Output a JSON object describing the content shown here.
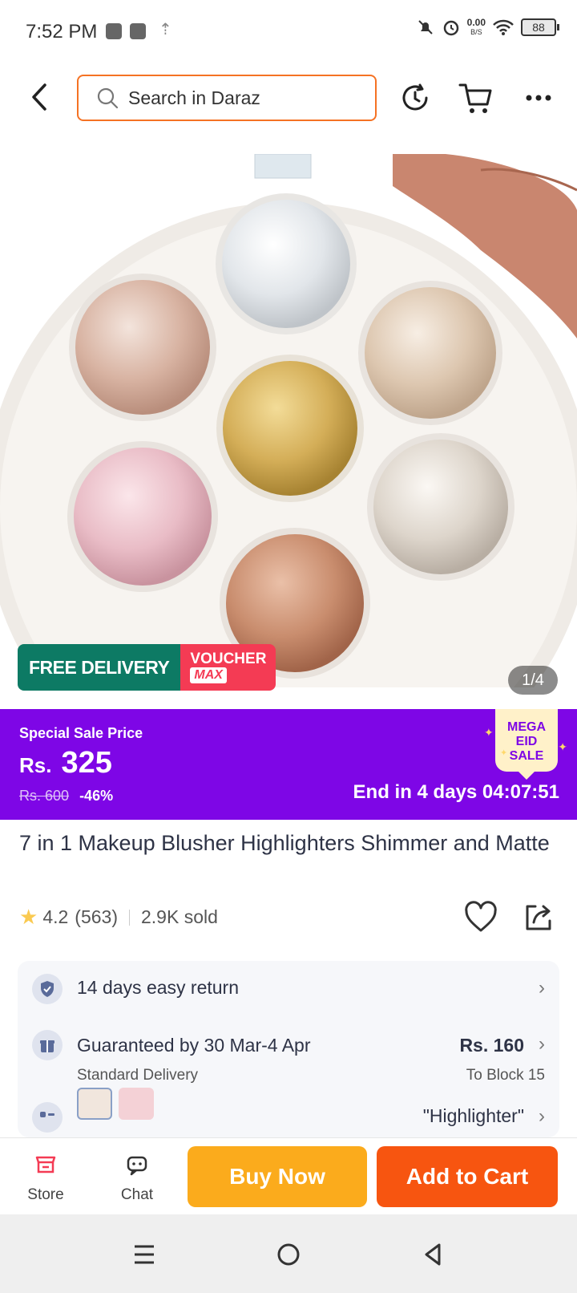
{
  "status_bar": {
    "time": "7:52 PM",
    "speed_value": "0.00",
    "speed_unit": "B/S",
    "battery": "88"
  },
  "header": {
    "search_placeholder": "Search in Daraz"
  },
  "gallery": {
    "badge_free_delivery": "FREE DELIVERY",
    "badge_voucher": "VOUCHER",
    "badge_max": "MAX",
    "counter": "1/4"
  },
  "price": {
    "label": "Special Sale Price",
    "currency": "Rs.",
    "value": "325",
    "old_price": "Rs. 600",
    "discount": "-46%",
    "countdown": "End in 4 days 04:07:51",
    "badge_line1": "MEGA EID",
    "badge_line2": "SALE",
    "band_color": "#7e06e6"
  },
  "product": {
    "title": "7 in 1 Makeup Blusher Highlighters Shimmer and Matte",
    "rating": "4.2",
    "reviews": "(563)",
    "sold": "2.9K sold"
  },
  "info": {
    "return_text": "14 days easy return",
    "delivery_text": "Guaranteed by 30 Mar-4 Apr",
    "delivery_sub": "Standard Delivery",
    "delivery_fee": "Rs. 160",
    "delivery_location": "To Block 15",
    "variant_text": "\"Highlighter\""
  },
  "actions": {
    "store": "Store",
    "chat": "Chat",
    "buy_now": "Buy Now",
    "add_to_cart": "Add to Cart"
  }
}
